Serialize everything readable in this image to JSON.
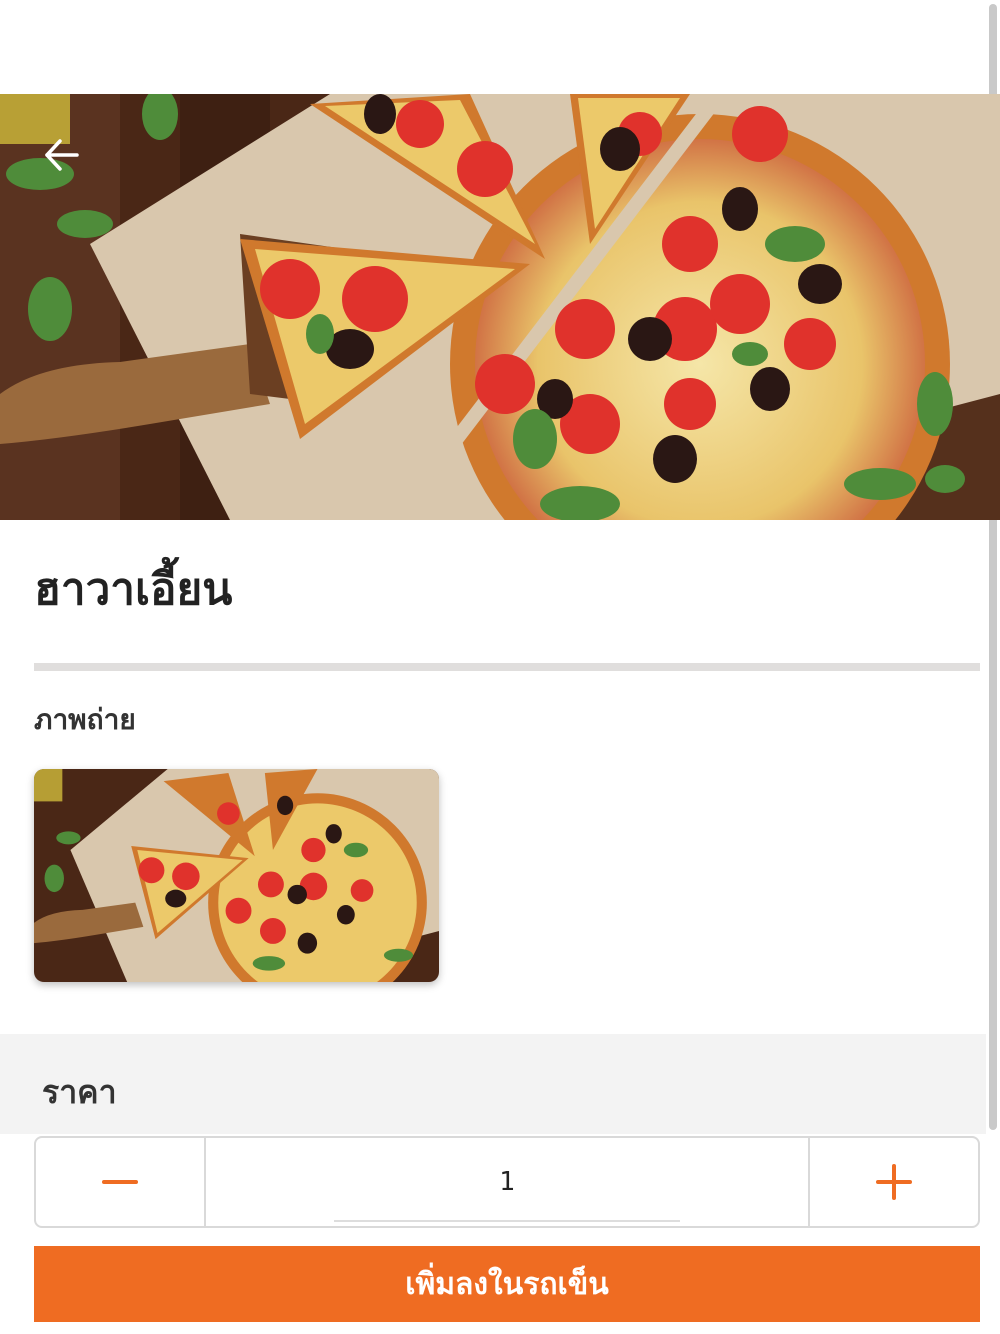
{
  "header": {
    "back_icon": "arrow-left-icon"
  },
  "product": {
    "title": "ฮาวาเอี้ยน",
    "hero_image": "pizza-photo"
  },
  "photos": {
    "label": "ภาพถ่าย",
    "items": [
      {
        "image": "pizza-photo"
      }
    ]
  },
  "price": {
    "label": "ราคา"
  },
  "quantity": {
    "value": "1",
    "minus_icon": "minus-icon",
    "plus_icon": "plus-icon"
  },
  "cart": {
    "button_label": "เพิ่มลงในรถเข็น"
  },
  "colors": {
    "accent": "#ef6c22",
    "divider": "#e0dedd",
    "section_bg": "#f3f3f3"
  }
}
